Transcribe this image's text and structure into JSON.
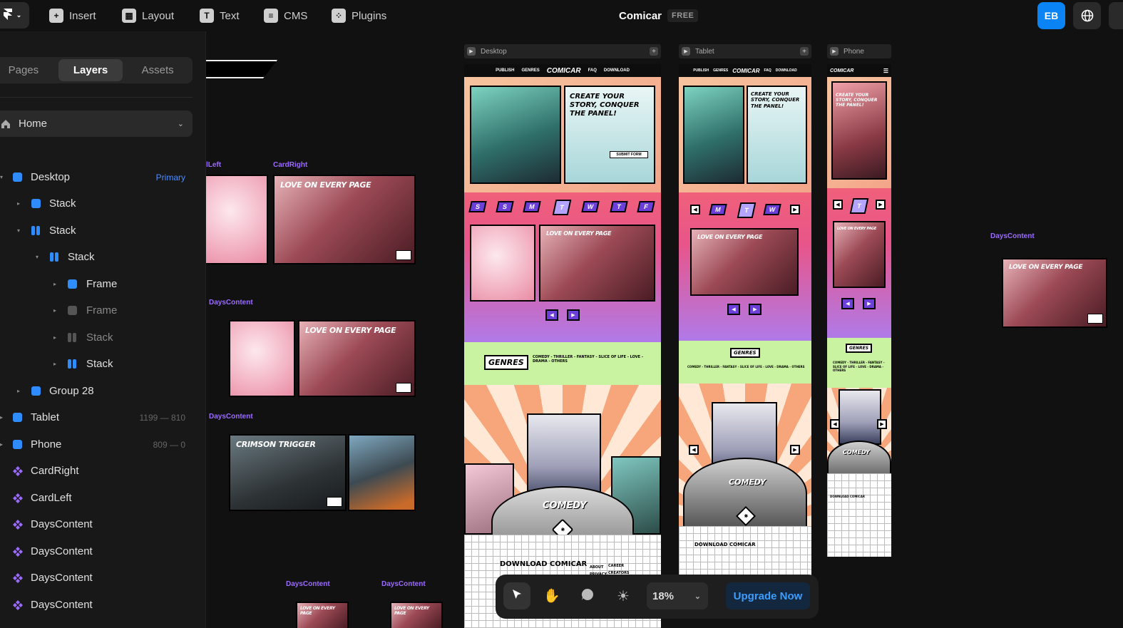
{
  "app": {
    "project_title": "Comicar",
    "plan_badge": "FREE",
    "user_initials": "EB"
  },
  "topbar": {
    "insert": "Insert",
    "layout": "Layout",
    "text": "Text",
    "cms": "CMS",
    "plugins": "Plugins"
  },
  "sidebar": {
    "tabs": [
      "Pages",
      "Layers",
      "Assets"
    ],
    "active_tab": "Layers",
    "page_select": "Home",
    "layers": [
      {
        "label": "Desktop",
        "meta": "Primary"
      },
      {
        "label": "Stack"
      },
      {
        "label": "Stack"
      },
      {
        "label": "Stack"
      },
      {
        "label": "Frame"
      },
      {
        "label": "Frame"
      },
      {
        "label": "Stack"
      },
      {
        "label": "Stack"
      },
      {
        "label": "Group 28"
      },
      {
        "label": "Tablet",
        "meta": "1199 — 810"
      },
      {
        "label": "Phone",
        "meta": "809 — 0"
      },
      {
        "label": "CardRight"
      },
      {
        "label": "CardLeft"
      },
      {
        "label": "DaysContent"
      },
      {
        "label": "DaysContent"
      },
      {
        "label": "DaysContent"
      },
      {
        "label": "DaysContent"
      }
    ]
  },
  "canvas": {
    "frames": {
      "desktop": "Desktop",
      "tablet": "Tablet",
      "phone": "Phone"
    },
    "component_labels": {
      "card_left": "lLeft",
      "card_right": "CardRight",
      "days_content": "DaysContent"
    },
    "cards": {
      "love": "LOVE ON EVERY PAGE",
      "crimson": "CRIMSON TRIGGER"
    },
    "site": {
      "nav_brand": "COMICAR",
      "nav_links": [
        "PUBLISH",
        "GENRES",
        "FAQ",
        "DOWNLOAD"
      ],
      "hero_heading": "CREATE YOUR STORY, CONQUER THE PANEL!",
      "hero_button": "SUBMIT FORM",
      "days": [
        "S",
        "S",
        "M",
        "T",
        "W",
        "T",
        "F"
      ],
      "tablet_days": [
        "M",
        "T",
        "W"
      ],
      "phone_day": "T",
      "genres_badge": "GENRES",
      "genres_list": "COMEDY - THRILLER - FANTASY - SLICE OF LIFE - LOVE - DRAMA - OTHERS",
      "featured_genre": "COMEDY",
      "download_heading": "DOWNLOAD COMICAR",
      "footer_links_col1": [
        "ABOUT",
        "PRIVACY"
      ],
      "footer_links_col2": [
        "CAREER",
        "CREATORS"
      ]
    }
  },
  "toolbar": {
    "zoom": "18%",
    "upgrade": "Upgrade Now"
  },
  "colors": {
    "accent": "#0a84f4",
    "component": "#9b6bff",
    "primary_label": "#4d8dff"
  }
}
